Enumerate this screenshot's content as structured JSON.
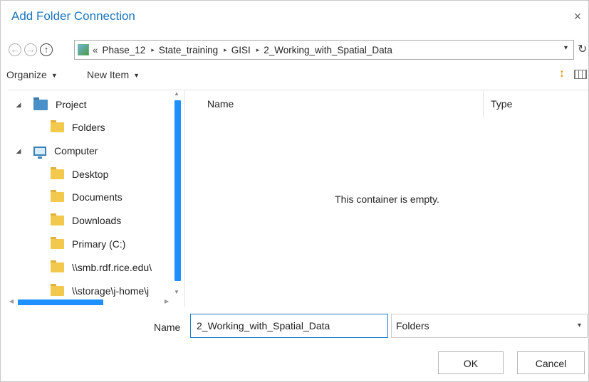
{
  "window": {
    "title": "Add Folder Connection",
    "close_glyph": "×"
  },
  "navigation": {
    "back_glyph": "←",
    "forward_glyph": "→",
    "up_glyph": "↑",
    "overflow_glyph": "«",
    "path": [
      "Phase_12",
      "State_training",
      "GISI",
      "2_Working_with_Spatial_Data"
    ],
    "separator_glyph": "▸",
    "dropdown_glyph": "▾",
    "refresh_glyph": "↻"
  },
  "toolbar": {
    "organize_label": "Organize",
    "new_item_label": "New Item",
    "caret_glyph": "▼",
    "sort_glyph": "↕"
  },
  "tree": {
    "expander_glyph": "◢",
    "items": [
      {
        "label": "Project"
      },
      {
        "label": "Folders"
      },
      {
        "label": "Computer"
      },
      {
        "label": "Desktop"
      },
      {
        "label": "Documents"
      },
      {
        "label": "Downloads"
      },
      {
        "label": "Primary (C:)"
      },
      {
        "label": "\\\\smb.rdf.rice.edu\\"
      },
      {
        "label": "\\\\storage\\j-home\\j"
      }
    ]
  },
  "content": {
    "columns": [
      "Name",
      "Type"
    ],
    "empty_message": "This container is empty."
  },
  "footer": {
    "name_label": "Name",
    "name_value": "2_Working_with_Spatial_Data",
    "type_value": "Folders",
    "type_dropdown_glyph": "▾",
    "ok_label": "OK",
    "cancel_label": "Cancel"
  },
  "colors": {
    "accent": "#1b75bc",
    "scroll_thumb": "#1e90ff",
    "folder": "#f2c94c"
  }
}
